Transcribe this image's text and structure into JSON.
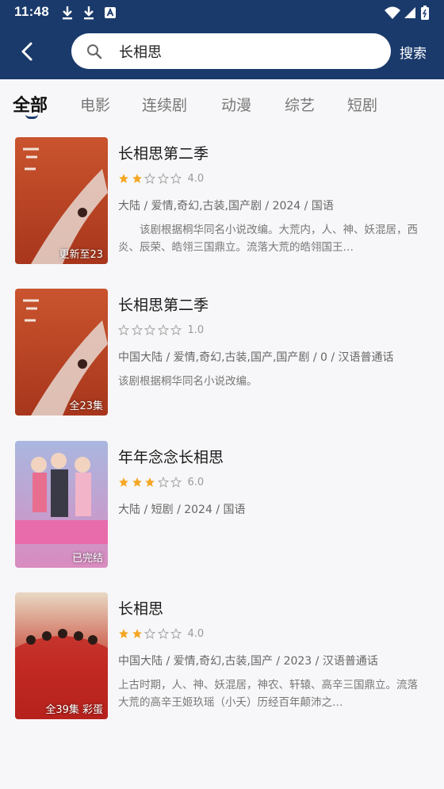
{
  "status_bar": {
    "time": "11:48",
    "icons": [
      "download-icon",
      "download-icon",
      "app-a-icon",
      "wifi-icon",
      "signal-icon",
      "battery-icon"
    ]
  },
  "search": {
    "query": "长相思",
    "button_label": "搜索"
  },
  "tabs": [
    {
      "label": "全部",
      "active": true
    },
    {
      "label": "电影",
      "active": false
    },
    {
      "label": "连续剧",
      "active": false
    },
    {
      "label": "动漫",
      "active": false
    },
    {
      "label": "综艺",
      "active": false
    },
    {
      "label": "短剧",
      "active": false
    }
  ],
  "colors": {
    "header": "#1a3a6b",
    "star_filled": "#f5a623",
    "star_empty": "#bbbbbb"
  },
  "results": [
    {
      "title": "长相思第二季",
      "rating_stars": 2,
      "score": "4.0",
      "meta": "大陆 / 爱情,奇幻,古装,国产剧 / 2024 / 国语",
      "description": "该剧根据桐华同名小说改编。大荒内，人、神、妖混居，西炎、辰荣、皓翎三国鼎立。流落大荒的皓翎国王…",
      "badge": "更新至23"
    },
    {
      "title": "长相思第二季",
      "rating_stars": 0,
      "score": "1.0",
      "meta": "中国大陆 / 爱情,奇幻,古装,国产,国产剧 / 0 / 汉语普通话",
      "description": "该剧根据桐华同名小说改编。",
      "badge": "全23集"
    },
    {
      "title": "年年念念长相思",
      "rating_stars": 3,
      "score": "6.0",
      "meta": "大陆 / 短剧 / 2024 / 国语",
      "description": "",
      "badge": "已完结"
    },
    {
      "title": "长相思",
      "rating_stars": 2,
      "score": "4.0",
      "meta": "中国大陆 / 爱情,奇幻,古装,国产 / 2023 / 汉语普通话",
      "description": "上古时期，人、神、妖混居，神农、轩辕、高辛三国鼎立。流落大荒的高辛王姬玖瑶（小夭）历经百年颠沛之…",
      "badge": "全39集 彩蛋"
    }
  ]
}
